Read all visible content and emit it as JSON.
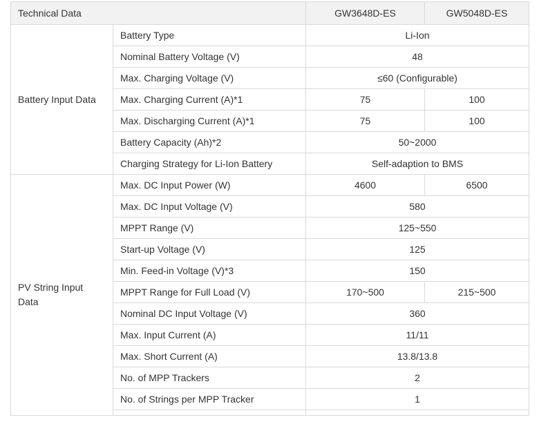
{
  "header": {
    "title": "Technical Data",
    "model1": "GW3648D-ES",
    "model2": "GW5048D-ES"
  },
  "groups": {
    "battery": "Battery Input Data",
    "pv": "PV String Input Data"
  },
  "rows": [
    {
      "label": "Battery Type",
      "value": "Li-Ion"
    },
    {
      "label": "Nominal Battery Voltage (V)",
      "value": "48"
    },
    {
      "label": "Max. Charging Voltage (V)",
      "value": "≤60 (Configurable)"
    },
    {
      "label": "Max. Charging Current (A)*1",
      "v1": "75",
      "v2": "100"
    },
    {
      "label": "Max. Discharging Current (A)*1",
      "v1": "75",
      "v2": "100"
    },
    {
      "label": "Battery Capacity (Ah)*2",
      "value": "50~2000"
    },
    {
      "label": "Charging Strategy for Li-Ion Battery",
      "value": "Self-adaption to BMS"
    },
    {
      "label": "Max. DC Input Power (W)",
      "v1": "4600",
      "v2": "6500"
    },
    {
      "label": "Max. DC Input Voltage (V)",
      "value": "580"
    },
    {
      "label": "MPPT Range (V)",
      "value": "125~550"
    },
    {
      "label": "Start-up Voltage (V)",
      "value": "125"
    },
    {
      "label": "Min. Feed-in Voltage (V)*3",
      "value": "150"
    },
    {
      "label": "MPPT Range for Full Load (V)",
      "v1": "170~500",
      "v2": "215~500"
    },
    {
      "label": "Nominal DC Input Voltage (V)",
      "value": "360"
    },
    {
      "label": "Max. Input Current (A)",
      "value": "11/11"
    },
    {
      "label": "Max. Short Current (A)",
      "value": "13.8/13.8"
    },
    {
      "label": "No. of MPP Trackers",
      "value": "2"
    },
    {
      "label": "No. of Strings per MPP Tracker",
      "value": "1"
    }
  ]
}
